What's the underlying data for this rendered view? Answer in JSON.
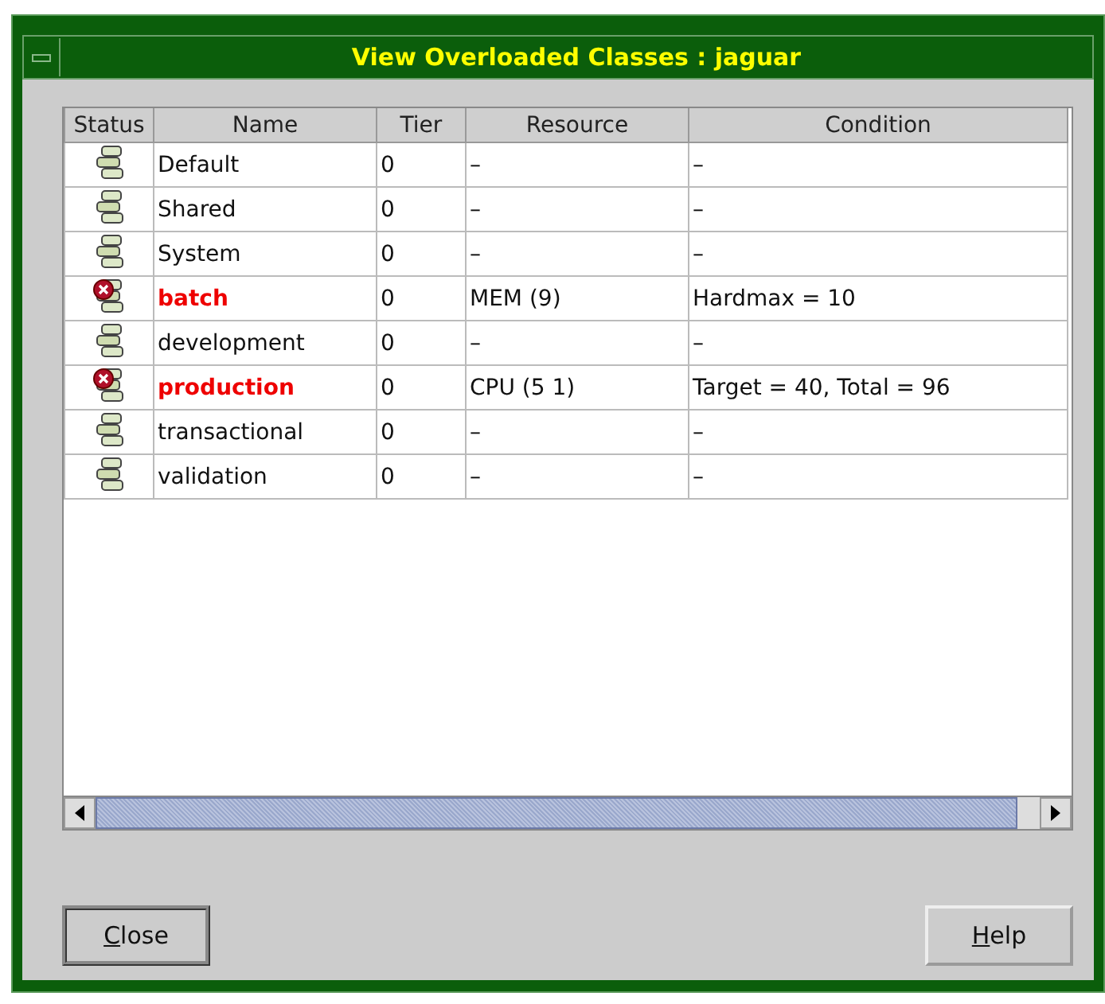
{
  "window": {
    "title": "View Overloaded Classes : jaguar"
  },
  "table": {
    "columns": [
      "Status",
      "Name",
      "Tier",
      "Resource",
      "Condition"
    ],
    "rows": [
      {
        "kind": "ok",
        "name": "Default",
        "tier": "0",
        "resource": "–",
        "condition": "–"
      },
      {
        "kind": "ok",
        "name": "Shared",
        "tier": "0",
        "resource": "–",
        "condition": "–"
      },
      {
        "kind": "ok",
        "name": "System",
        "tier": "0",
        "resource": "–",
        "condition": "–"
      },
      {
        "kind": "overloaded",
        "name": "batch",
        "tier": "0",
        "resource": "MEM (9)",
        "condition": "Hardmax = 10"
      },
      {
        "kind": "ok",
        "name": "development",
        "tier": "0",
        "resource": "–",
        "condition": "–"
      },
      {
        "kind": "overloaded",
        "name": "production",
        "tier": "0",
        "resource": "CPU (5 1)",
        "condition": "Target = 40, Total = 96"
      },
      {
        "kind": "ok",
        "name": "transactional",
        "tier": "0",
        "resource": "–",
        "condition": "–"
      },
      {
        "kind": "ok",
        "name": "validation",
        "tier": "0",
        "resource": "–",
        "condition": "–"
      }
    ]
  },
  "buttons": [
    "Close",
    "Help"
  ]
}
